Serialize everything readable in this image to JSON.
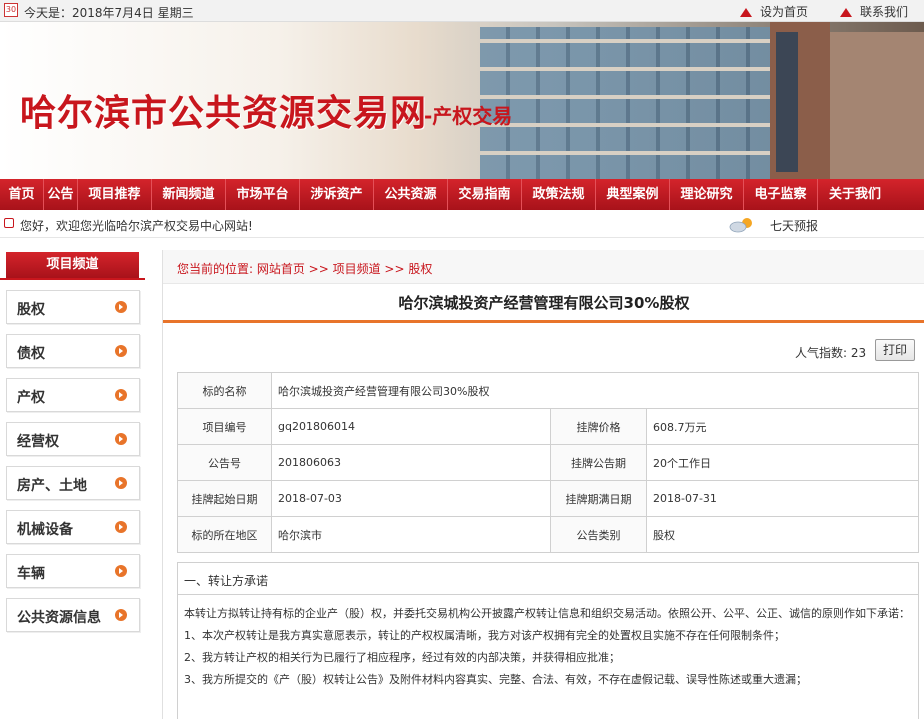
{
  "topbar": {
    "calendar_label": "30",
    "date_text": "今天是：2018年7月4日 星期三",
    "set_home": "设为首页",
    "contact": "联系我们"
  },
  "banner": {
    "site_title": "哈尔滨市公共资源交易网",
    "site_sub": "-产权交易"
  },
  "nav": {
    "items": [
      "首页",
      "公告",
      "项目推荐",
      "新闻频道",
      "市场平台",
      "涉诉资产",
      "公共资源",
      "交易指南",
      "政策法规",
      "典型案例",
      "理论研究",
      "电子监察",
      "关于我们"
    ]
  },
  "welcome": {
    "message": "您好，欢迎您光临哈尔滨产权交易中心网站!",
    "forecast": "七天预报"
  },
  "sidebar": {
    "heading": "项目频道",
    "items": [
      "股权",
      "债权",
      "产权",
      "经营权",
      "房产、土地",
      "机械设备",
      "车辆",
      "公共资源信息"
    ]
  },
  "main": {
    "breadcrumb": "您当前的位置: 网站首页 >> 项目频道 >> 股权",
    "title": "哈尔滨城投资产经营管理有限公司30%股权",
    "views_label": "人气指数: 23",
    "print_label": "打印",
    "table": {
      "row1": {
        "k": "标的名称",
        "v": "哈尔滨城投资产经营管理有限公司30%股权"
      },
      "row2": {
        "k1": "项目编号",
        "v1": "gq201806014",
        "k2": "挂牌价格",
        "v2": "608.7万元"
      },
      "row3": {
        "k1": "公告号",
        "v1": "201806063",
        "k2": "挂牌公告期",
        "v2": "20个工作日"
      },
      "row4": {
        "k1": "挂牌起始日期",
        "v1": "2018-07-03",
        "k2": "挂牌期满日期",
        "v2": "2018-07-31"
      },
      "row5": {
        "k1": "标的所在地区",
        "v1": "哈尔滨市",
        "k2": "公告类别",
        "v2": "股权"
      }
    },
    "commit": {
      "heading": "一、转让方承诺",
      "p1": "本转让方拟转让持有标的企业产（股）权，并委托交易机构公开披露产权转让信息和组织交易活动。依照公开、公平、公正、诚信的原则作如下承诺：",
      "p2": "1、本次产权转让是我方真实意愿表示，转让的产权权属清晰，我方对该产权拥有完全的处置权且实施不存在任何限制条件；",
      "p3": "2、我方转让产权的相关行为已履行了相应程序，经过有效的内部决策，并获得相应批准；",
      "p4": "3、我方所提交的《产（股）权转让公告》及附件材料内容真实、完整、合法、有效，不存在虚假记载、误导性陈述或重大遗漏；"
    }
  },
  "colors": {
    "brand_red": "#c8161d",
    "accent_orange": "#e8742a"
  }
}
